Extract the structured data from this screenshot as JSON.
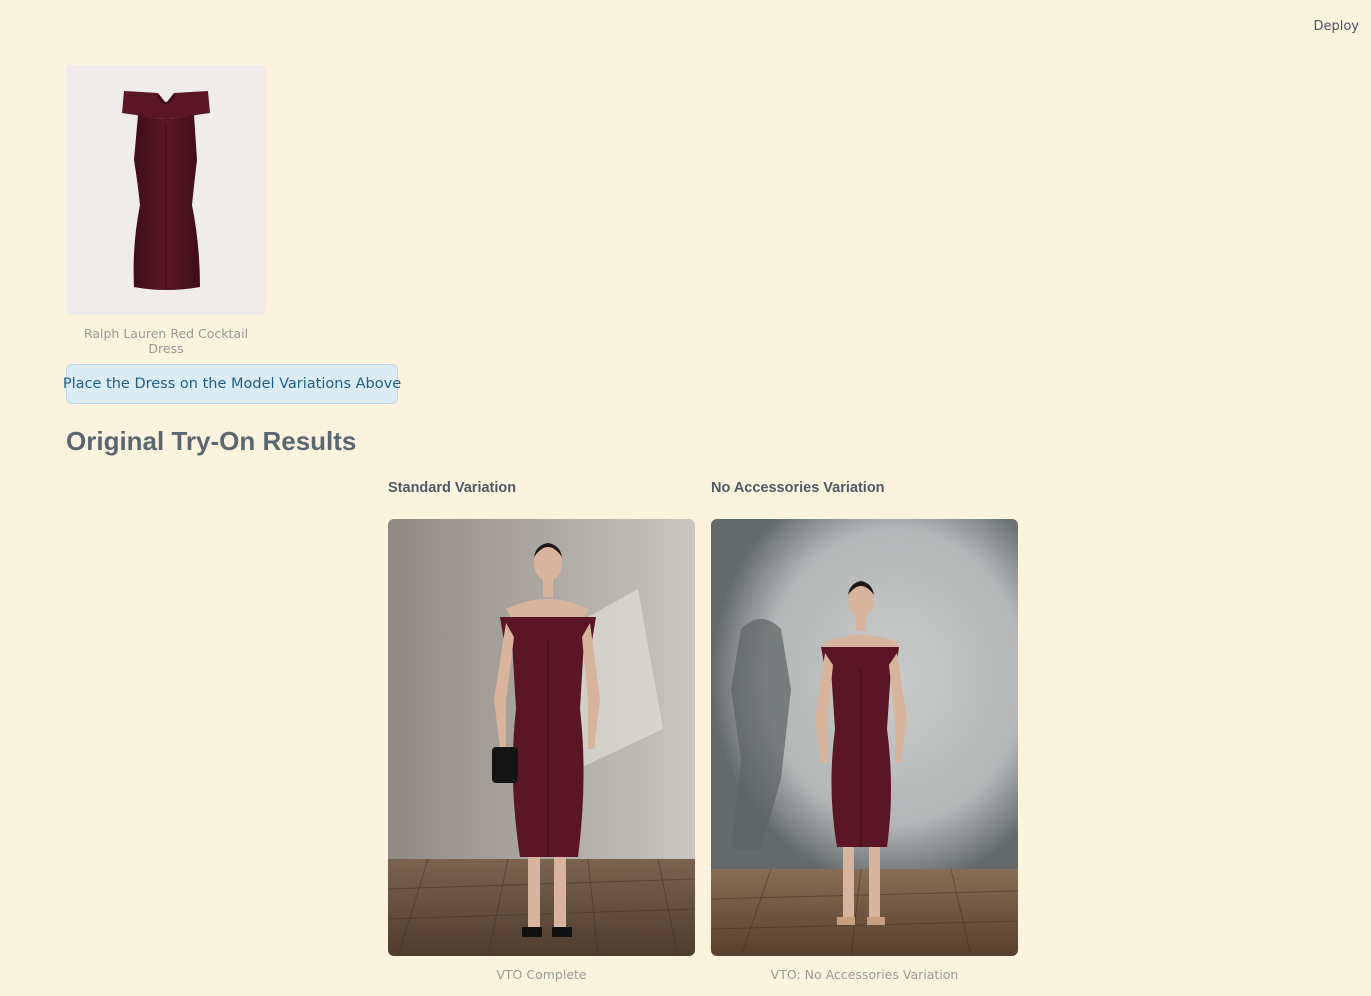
{
  "header": {
    "deploy_label": "Deploy"
  },
  "product": {
    "caption": "Ralph Lauren Red Cocktail Dress"
  },
  "action": {
    "place_button_label": "Place the Dress on the Model Variations Above"
  },
  "results": {
    "title": "Original Try-On Results",
    "variations": [
      {
        "label": "Standard Variation",
        "caption": "VTO Complete"
      },
      {
        "label": "No Accessories Variation",
        "caption": "VTO: No Accessories Variation"
      }
    ]
  },
  "colors": {
    "background": "#fcf3df",
    "dress": "#5a1624",
    "button_bg": "#dcecf5",
    "button_text": "#1e5f8a"
  }
}
